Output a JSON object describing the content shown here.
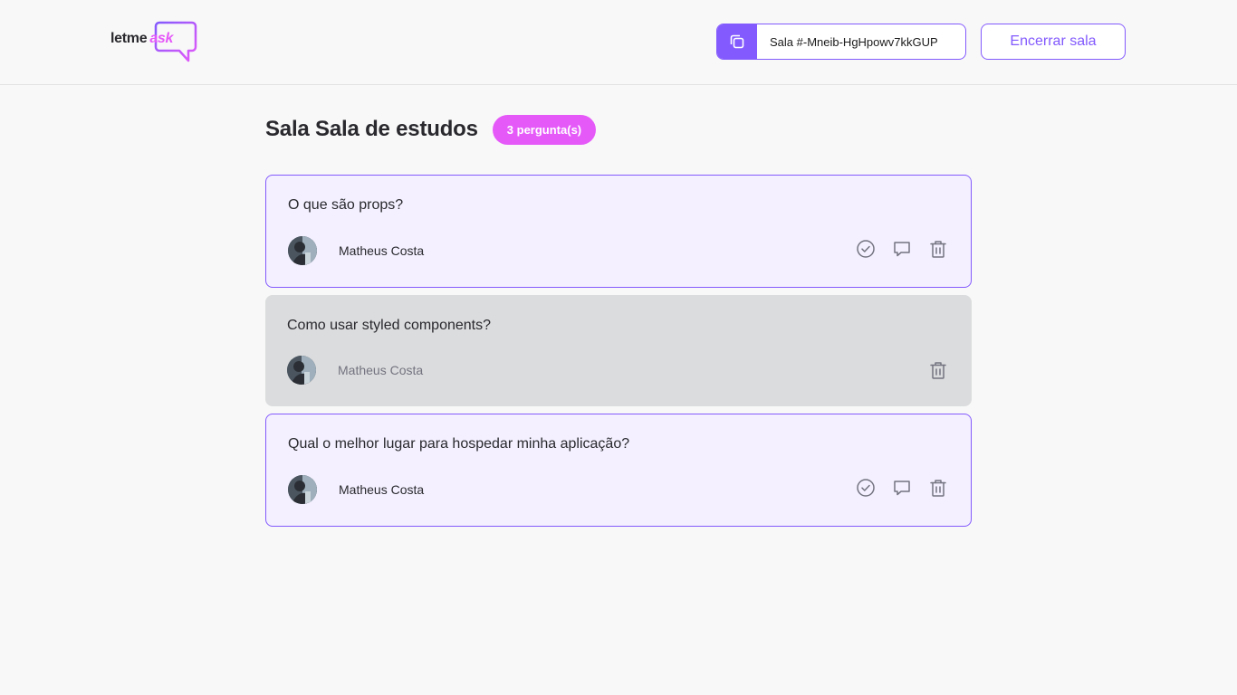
{
  "header": {
    "logo": {
      "text": "letme",
      "accent": "ask"
    },
    "room_code": {
      "label": "Sala #-Mneib-HgHpowv7kkGUP"
    },
    "end_room_label": "Encerrar sala"
  },
  "room": {
    "title": "Sala Sala de estudos",
    "question_count": "3 pergunta(s)"
  },
  "questions": [
    {
      "content": "O que são props?",
      "author": "Matheus Costa",
      "state": "highlighted"
    },
    {
      "content": "Como usar styled components?",
      "author": "Matheus Costa",
      "state": "answered"
    },
    {
      "content": "Qual o melhor lugar para hospedar minha aplicação?",
      "author": "Matheus Costa",
      "state": "highlighted"
    }
  ],
  "colors": {
    "purple": "#835afd",
    "pink": "#e559f9",
    "highlight_bg": "#f4f0ff",
    "answered_bg": "#dbdcdd",
    "page_bg": "#f8f8f8"
  },
  "icons": {
    "copy": "copy-icon",
    "check": "check-icon",
    "answer": "chat-bubble-icon",
    "delete": "trash-icon"
  }
}
